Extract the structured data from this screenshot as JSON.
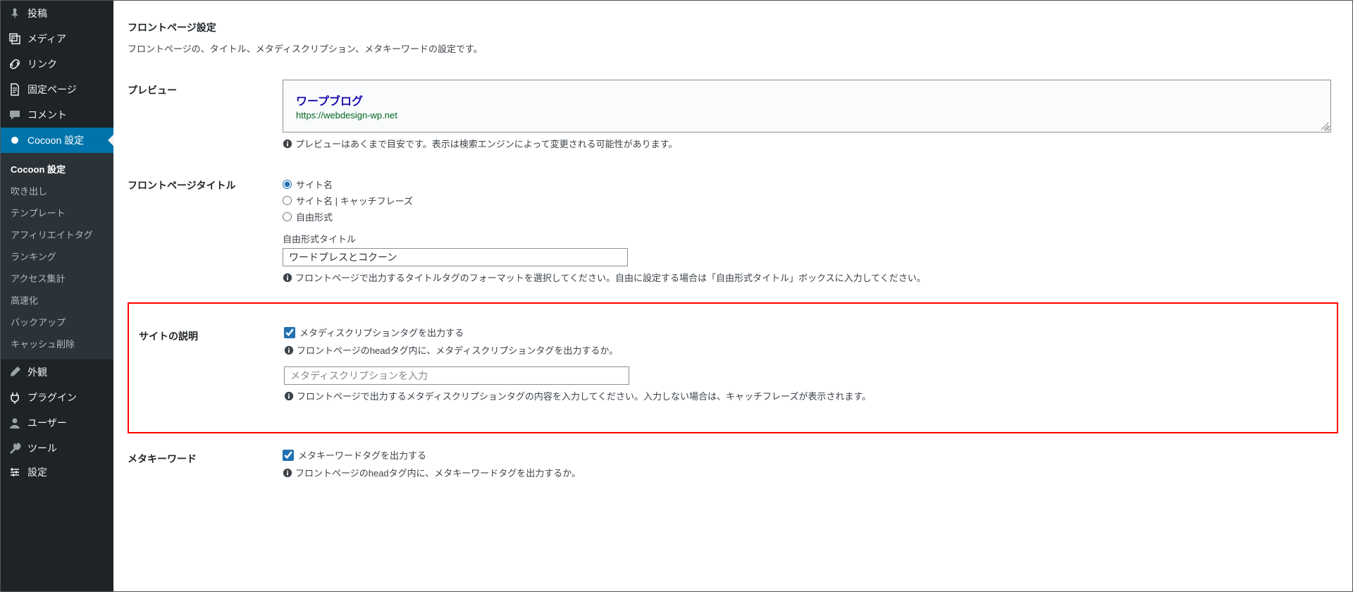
{
  "sidebar": {
    "items": [
      {
        "label": "投稿",
        "icon": "pushpin"
      },
      {
        "label": "メディア",
        "icon": "media"
      },
      {
        "label": "リンク",
        "icon": "link"
      },
      {
        "label": "固定ページ",
        "icon": "page"
      },
      {
        "label": "コメント",
        "icon": "comment"
      },
      {
        "label": "Cocoon 設定",
        "icon": "dot",
        "active": true
      },
      {
        "label": "外観",
        "icon": "brush"
      },
      {
        "label": "プラグイン",
        "icon": "plugin"
      },
      {
        "label": "ユーザー",
        "icon": "user"
      },
      {
        "label": "ツール",
        "icon": "tool"
      },
      {
        "label": "設定",
        "icon": "settings"
      }
    ],
    "submenu": [
      "Cocoon 設定",
      "吹き出し",
      "テンプレート",
      "アフィリエイトタグ",
      "ランキング",
      "アクセス集計",
      "高速化",
      "バックアップ",
      "キャッシュ削除"
    ]
  },
  "section": {
    "heading": "フロントページ設定",
    "desc": "フロントページの、タイトル、メタディスクリプション、メタキーワードの設定です。"
  },
  "rows": {
    "preview": {
      "label": "プレビュー",
      "title": "ワープブログ",
      "url": "https://webdesign-wp.net",
      "note": "プレビューはあくまで目安です。表示は検索エンジンによって変更される可能性があります。"
    },
    "title": {
      "label": "フロントページタイトル",
      "opt1": "サイト名",
      "opt2": "サイト名 | キャッチフレーズ",
      "opt3": "自由形式",
      "free_label": "自由形式タイトル",
      "free_value": "ワードプレスとコクーン",
      "note": "フロントページで出力するタイトルタグのフォーマットを選択してください。自由に設定する場合は「自由形式タイトル」ボックスに入力してください。"
    },
    "desc_row": {
      "label": "サイトの説明",
      "chk_label": "メタディスクリプションタグを出力する",
      "note1": "フロントページのheadタグ内に、メタディスクリプションタグを出力するか。",
      "placeholder": "メタディスクリプションを入力",
      "note2": "フロントページで出力するメタディスクリプションタグの内容を入力してください。入力しない場合は、キャッチフレーズが表示されます。"
    },
    "keyword": {
      "label": "メタキーワード",
      "chk_label": "メタキーワードタグを出力する",
      "note1": "フロントページのheadタグ内に、メタキーワードタグを出力するか。"
    }
  }
}
